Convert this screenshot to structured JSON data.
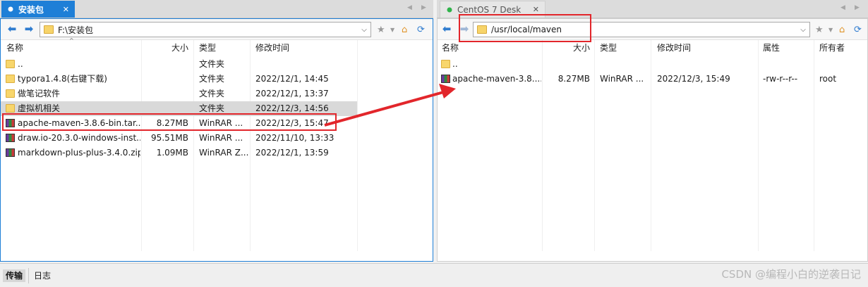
{
  "tabs": {
    "left": {
      "label": "安装包"
    },
    "right": {
      "label": "CentOS 7 Desk"
    }
  },
  "left_pane": {
    "path": "F:\\安装包",
    "columns": [
      "名称",
      "大小",
      "类型",
      "修改时间"
    ],
    "rows": [
      {
        "name": "..",
        "size": "",
        "type": "文件夹",
        "modified": "",
        "icon": "folder"
      },
      {
        "name": "typora1.4.8(右键下载)",
        "size": "",
        "type": "文件夹",
        "modified": "2022/12/1, 14:45",
        "icon": "folder"
      },
      {
        "name": "做笔记软件",
        "size": "",
        "type": "文件夹",
        "modified": "2022/12/1, 13:37",
        "icon": "folder"
      },
      {
        "name": "虚拟机相关",
        "size": "",
        "type": "文件夹",
        "modified": "2022/12/3, 14:56",
        "icon": "folder"
      },
      {
        "name": "apache-maven-3.8.6-bin.tar....",
        "size": "8.27MB",
        "type": "WinRAR ...",
        "modified": "2022/12/3, 15:47",
        "icon": "rar-archive"
      },
      {
        "name": "draw.io-20.3.0-windows-inst...",
        "size": "95.51MB",
        "type": "WinRAR ...",
        "modified": "2022/11/10, 13:33",
        "icon": "rar-archive"
      },
      {
        "name": "markdown-plus-plus-3.4.0.zip",
        "size": "1.09MB",
        "type": "WinRAR Z...",
        "modified": "2022/12/1, 13:59",
        "icon": "rar-archive"
      }
    ]
  },
  "right_pane": {
    "path": "/usr/local/maven",
    "columns": [
      "名称",
      "大小",
      "类型",
      "修改时间",
      "属性",
      "所有者"
    ],
    "rows": [
      {
        "name": "..",
        "size": "",
        "type": "",
        "modified": "",
        "attrs": "",
        "owner": "",
        "icon": "folder"
      },
      {
        "name": "apache-maven-3.8....",
        "size": "8.27MB",
        "type": "WinRAR ...",
        "modified": "2022/12/3, 15:49",
        "attrs": "-rw-r--r--",
        "owner": "root",
        "icon": "rar-archive"
      }
    ]
  },
  "bottom": {
    "tabs": [
      "传输",
      "日志"
    ],
    "watermark": "CSDN @编程小白的逆袭日记"
  },
  "colors": {
    "accent": "#1e7fd7",
    "annotation_red": "#e2262b",
    "status_green": "#2fb34a"
  }
}
